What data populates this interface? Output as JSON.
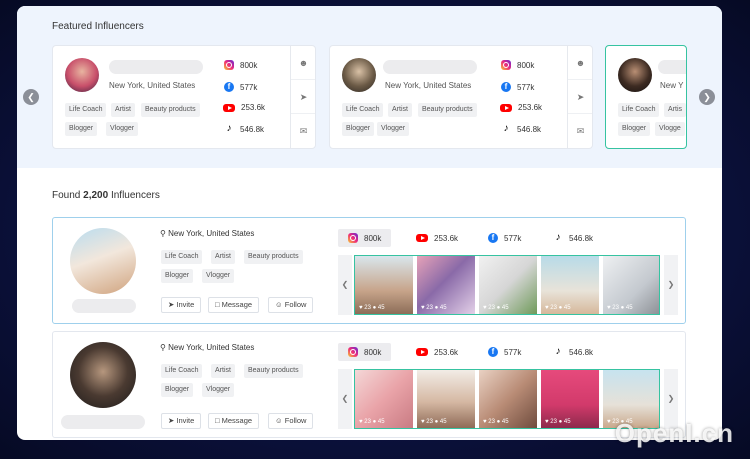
{
  "featured": {
    "title": "Featured Influencers",
    "prev_icon": "chevron-left-icon",
    "next_icon": "chevron-right-icon",
    "cards": [
      {
        "location": "New York, United States",
        "tags": [
          "Life Coach",
          "Artist",
          "Beauty products",
          "Blogger",
          "Vlogger"
        ],
        "stats": {
          "instagram": "800k",
          "facebook": "577k",
          "youtube": "253.6k",
          "tiktok": "546.8k"
        }
      },
      {
        "location": "New York, United States",
        "tags": [
          "Life Coach",
          "Artist",
          "Beauty products",
          "Blogger",
          "Vlogger"
        ],
        "stats": {
          "instagram": "800k",
          "facebook": "577k",
          "youtube": "253.6k",
          "tiktok": "546.8k"
        }
      },
      {
        "location": "New Y",
        "tags": [
          "Life Coach",
          "Artis",
          "Blogger",
          "Vlogge"
        ]
      }
    ]
  },
  "results": {
    "found_prefix": "Found",
    "count": "2,200",
    "found_suffix": "Influencers",
    "buttons": {
      "invite": "Invite",
      "message": "Message",
      "follow": "Follow"
    },
    "rows": [
      {
        "location": "New York, United States",
        "tags": [
          "Life Coach",
          "Artist",
          "Beauty products",
          "Blogger",
          "Vlogger"
        ],
        "stats": {
          "instagram": "800k",
          "youtube": "253.6k",
          "facebook": "577k",
          "tiktok": "546.8k"
        },
        "post_likes": "23",
        "post_comments": "45"
      },
      {
        "location": "New York, United States",
        "tags": [
          "Life Coach",
          "Artist",
          "Beauty products",
          "Blogger",
          "Vlogger"
        ],
        "stats": {
          "instagram": "800k",
          "youtube": "253.6k",
          "facebook": "577k",
          "tiktok": "546.8k"
        },
        "post_likes": "23",
        "post_comments": "45"
      }
    ]
  },
  "watermark": "OpenI.cn",
  "colors": {
    "accent": "#36c3a1",
    "selected_border": "#9fd0ec",
    "featured_bg": "#eef4fd"
  }
}
